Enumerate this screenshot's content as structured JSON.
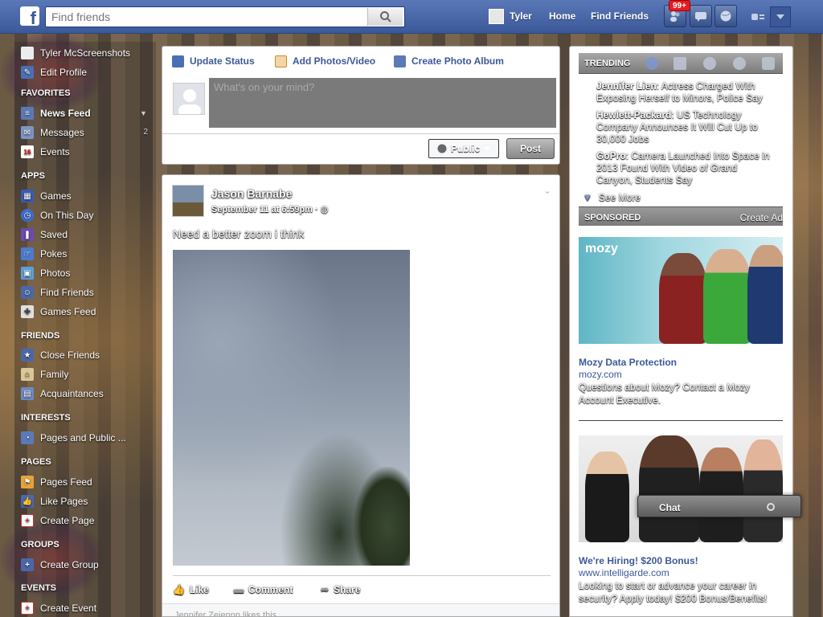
{
  "topbar": {
    "logo": "f",
    "search_placeholder": "Find friends",
    "profile_name": "Tyler",
    "links": [
      "Home",
      "Find Friends"
    ],
    "notification_count": "99+"
  },
  "sidebar": {
    "profile": [
      {
        "label": "Tyler McScreenshots",
        "icon": "profile-icon"
      },
      {
        "label": "Edit Profile",
        "icon": "pencil-icon"
      }
    ],
    "sections": [
      {
        "heading": "FAVORITES",
        "items": [
          {
            "label": "News Feed",
            "icon": "news-feed-icon",
            "selected": true
          },
          {
            "label": "Messages",
            "icon": "messages-icon",
            "count": "2"
          },
          {
            "label": "Events",
            "icon": "calendar-icon",
            "badge": "16"
          }
        ]
      },
      {
        "heading": "APPS",
        "items": [
          {
            "label": "Games",
            "icon": "games-icon"
          },
          {
            "label": "On This Day",
            "icon": "clock-icon"
          },
          {
            "label": "Saved",
            "icon": "bookmark-icon"
          },
          {
            "label": "Pokes",
            "icon": "poke-icon"
          },
          {
            "label": "Photos",
            "icon": "photos-icon"
          },
          {
            "label": "Find Friends",
            "icon": "friends-icon"
          },
          {
            "label": "Games Feed",
            "icon": "gamepad-icon"
          }
        ]
      },
      {
        "heading": "FRIENDS",
        "items": [
          {
            "label": "Close Friends",
            "icon": "star-icon"
          },
          {
            "label": "Family",
            "icon": "house-icon"
          },
          {
            "label": "Acquaintances",
            "icon": "building-icon"
          }
        ]
      },
      {
        "heading": "INTERESTS",
        "items": [
          {
            "label": "Pages and Public ...",
            "icon": "rss-icon"
          }
        ]
      },
      {
        "heading": "PAGES",
        "items": [
          {
            "label": "Pages Feed",
            "icon": "flag-icon"
          },
          {
            "label": "Like Pages",
            "icon": "thumbs-up-icon"
          },
          {
            "label": "Create Page",
            "icon": "plus-icon"
          }
        ]
      },
      {
        "heading": "GROUPS",
        "items": [
          {
            "label": "Create Group",
            "icon": "plus-icon"
          }
        ]
      },
      {
        "heading": "EVENTS",
        "items": [
          {
            "label": "Create Event",
            "icon": "plus-icon"
          }
        ]
      }
    ]
  },
  "composer": {
    "tabs": [
      "Update Status",
      "Add Photos/Video",
      "Create Photo Album"
    ],
    "placeholder": "What's on your mind?",
    "privacy": "Public",
    "post_label": "Post"
  },
  "post": {
    "author": "Jason Barnabe",
    "date": "September 11 at 6:59pm · ",
    "text": "Need a better zoom i think",
    "actions": [
      "Like",
      "Comment",
      "Share"
    ],
    "footer": "Jennifer Zeiennn likes this"
  },
  "trending": {
    "heading": "TRENDING",
    "items": [
      {
        "topic": "Jennifer Lien",
        "text": ": Actress Charged With Exposing Herself to Minors, Police Say"
      },
      {
        "topic": "Hewlett-Packard",
        "text": ": US Technology Company Announces It Will Cut Up to 30,000 Jobs"
      },
      {
        "topic": "GoPro",
        "text": ": Camera Launched Into Space in 2013 Found With Video of Grand Canyon, Students Say"
      }
    ],
    "see_more": "See More"
  },
  "sponsored": {
    "heading": "SPONSORED",
    "create_ad": "Create Ad",
    "ads": [
      {
        "brand_logo": "mozy",
        "title": "Mozy Data Protection",
        "url": "mozy.com",
        "body": "Questions about Mozy? Contact a Mozy Account Executive."
      },
      {
        "title": "We're Hiring! $200 Bonus!",
        "url": "www.intelligarde.com",
        "body": "Looking to start or advance your career in security? Apply today! $200 Bonus/Benefits!"
      }
    ]
  },
  "chat": {
    "label": "Chat"
  },
  "colors": {
    "brand": "#3b5998",
    "badge": "#e31c23"
  }
}
